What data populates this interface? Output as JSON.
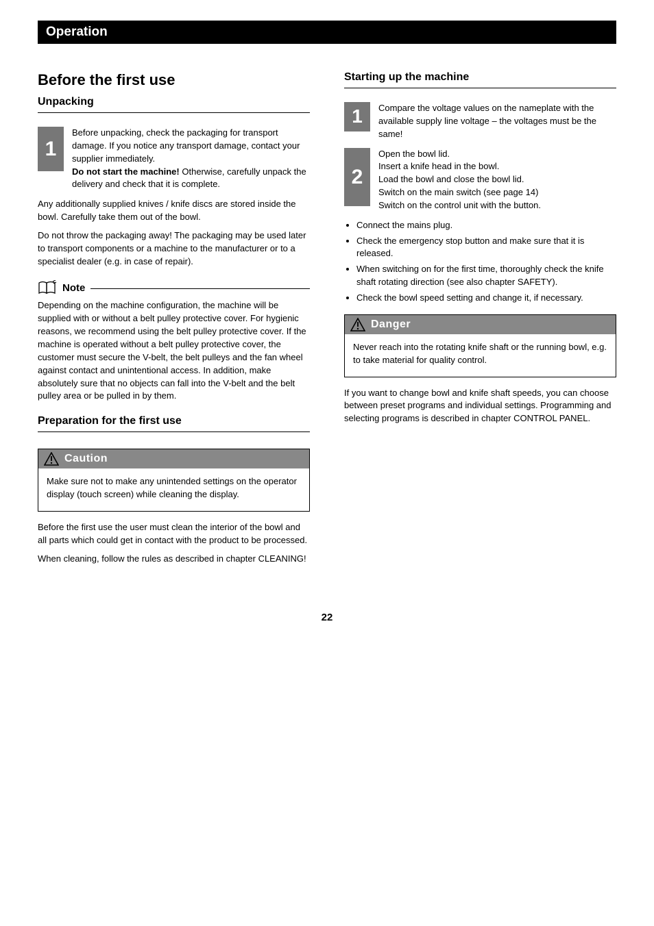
{
  "header_bar": "Operation",
  "left": {
    "main_title": "Before the first use",
    "sub_title": "Unpacking",
    "intro_num": "1",
    "intro_text_1": "Before unpacking, check the packaging for transport damage. If you notice any transport damage, contact your supplier immediately.",
    "intro_text_2_b": "Do not start the machine! ",
    "intro_text_2": "Otherwise, carefully unpack the delivery and check that it is complete.",
    "unpack_p1": "Any additionally supplied knives / knife discs are stored inside the bowl. Carefully take them out of the bowl.",
    "unpack_p2": "Do not throw the packaging away! The packaging may be used later to transport components or a machine to the manufacturer or to a specialist dealer (e.g. in case of repair).",
    "note_label": "Note",
    "note_text": "Depending on the machine configuration, the machine will be supplied with or without a belt pulley protective cover. For hygienic reasons, we recommend using the belt pulley protective cover. If the machine is operated without a belt pulley protective cover, the customer must secure the V-belt, the belt pulleys and the fan wheel against contact and unintentional access. In addition, make absolutely sure that no objects can fall into the V-belt and the belt pulley area or be pulled in by them.",
    "firstuse_title": "Preparation for the first use",
    "caution_label": "Caution",
    "caution_text": "Make sure not to make any unintended settings on the operator display (touch screen) while cleaning the display.",
    "firstuse_p1": "Before the first use the user must clean the interior of the bowl and all parts which could get in contact with the product to be processed.",
    "firstuse_p2": "When cleaning, follow the rules as described in chapter CLEANING!"
  },
  "right": {
    "startup_title": "Starting up the machine",
    "startup_num1": "1",
    "startup_num1_text": "Compare the voltage values on the nameplate with the available supply line voltage – the voltages must be the same!",
    "startup_num2": "2",
    "startup_num2_text": "Open the bowl lid.\nInsert a knife head in the bowl.\nLoad the bowl and close the bowl lid.\nSwitch on the main switch (see page 14)\nSwitch on the control unit with the button.",
    "startup_bullets": [
      "Connect the mains plug.",
      "Check the emergency stop button and make sure that it is released.",
      "When switching on for the first time, thoroughly check the knife shaft rotating direction (see also chapter SAFETY).",
      "Check the bowl speed setting and change it, if necessary."
    ],
    "danger_label": "Danger",
    "danger_text": "Never reach into the rotating knife shaft or the running bowl, e.g. to take material for quality control.",
    "startup_p": "If you want to change bowl and knife shaft speeds, you can choose between preset programs and individual settings. Programming and selecting programs is described in chapter CONTROL PANEL."
  },
  "page_number": "22"
}
